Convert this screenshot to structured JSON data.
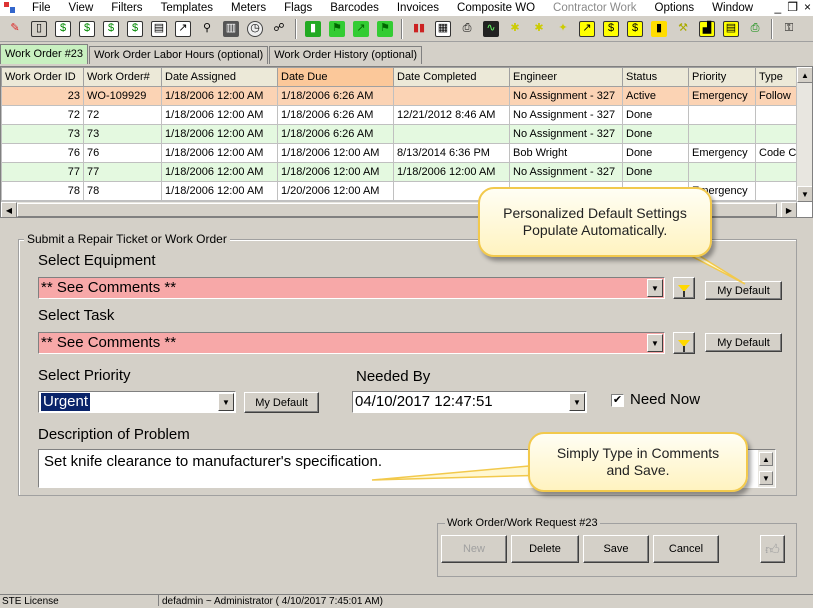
{
  "menu": {
    "items": [
      "File",
      "View",
      "Filters",
      "Templates",
      "Meters",
      "Flags",
      "Barcodes",
      "Invoices",
      "Composite WO",
      "Contractor Work",
      "Options",
      "Window"
    ],
    "disabled": [
      "Contractor Work"
    ],
    "window_controls": {
      "minimize": "_",
      "restore": "❐",
      "close": "×"
    }
  },
  "toolbar": {
    "icons": [
      "wrench-red-icon",
      "trash-icon",
      "dollar-doc-icon",
      "dollar-doc-icon",
      "dollar-doc-icon",
      "dollar-doc-icon",
      "doc-icon",
      "arrow-doc-icon",
      "search-icon",
      "barcode-icon",
      "dial-icon",
      "network-icon",
      "battery-icon",
      "flag-green-icon",
      "arrow-green-icon",
      "flag-green-icon",
      "chart-bar-icon",
      "calendar-icon",
      "printer-icon",
      "chart-icon",
      "robot-icon",
      "robot-icon",
      "sparkle-icon",
      "arrow-yellow-icon",
      "dollar-yellow-icon",
      "dollar-yellow-icon",
      "battery-yellow-icon",
      "tools-icon",
      "chart-yellow-icon",
      "doc-yellow-icon",
      "printer-green-icon",
      "key-icon"
    ]
  },
  "tabs": [
    {
      "label": "Work Order #23",
      "active": true
    },
    {
      "label": "Work Order Labor Hours (optional)",
      "active": false
    },
    {
      "label": "Work Order History (optional)",
      "active": false
    }
  ],
  "grid": {
    "columns": [
      "Work Order ID",
      "Work Order#",
      "Date Assigned",
      "Date Due",
      "Date Completed",
      "Engineer",
      "Status",
      "Priority",
      "Type"
    ],
    "sorted_column": "Date Due",
    "rows": [
      [
        "23",
        "WO-109929",
        "1/18/2006 12:00 AM",
        "1/18/2006 6:26 AM",
        "",
        "No Assignment - 327",
        "Active",
        "Emergency",
        "Follow"
      ],
      [
        "72",
        "72",
        "1/18/2006 12:00 AM",
        "1/18/2006 6:26 AM",
        "12/21/2012 8:46 AM",
        "No Assignment - 327",
        "Done",
        "",
        ""
      ],
      [
        "73",
        "73",
        "1/18/2006 12:00 AM",
        "1/18/2006 6:26 AM",
        "",
        "No Assignment - 327",
        "Done",
        "",
        ""
      ],
      [
        "76",
        "76",
        "1/18/2006 12:00 AM",
        "1/18/2006 12:00 AM",
        "8/13/2014 6:36 PM",
        "Bob Wright",
        "Done",
        "Emergency",
        "Code C"
      ],
      [
        "77",
        "77",
        "1/18/2006 12:00 AM",
        "1/18/2006 12:00 AM",
        "1/18/2006 12:00 AM",
        "No Assignment - 327",
        "Done",
        "",
        ""
      ],
      [
        "78",
        "78",
        "1/18/2006 12:00 AM",
        "1/20/2006 12:00 AM",
        "",
        "",
        "",
        "Emergency",
        ""
      ]
    ]
  },
  "form": {
    "group_title": "Submit a Repair Ticket or Work Order",
    "equipment": {
      "label": "Select Equipment",
      "value": "** See Comments **",
      "default_button": "My Default"
    },
    "task": {
      "label": "Select Task",
      "value": "** See Comments **",
      "default_button": "My Default"
    },
    "priority": {
      "label": "Select Priority",
      "value": "Urgent",
      "default_button": "My Default"
    },
    "needed_by": {
      "label": "Needed By",
      "value": "04/10/2017 12:47:51"
    },
    "need_now": {
      "label": "Need Now",
      "checked": true
    },
    "description": {
      "label": "Description of Problem",
      "value": "Set knife clearance to manufacturer's specification."
    }
  },
  "callouts": {
    "defaults": "Personalized Default Settings Populate Automatically.",
    "comments": "Simply Type in Comments and Save."
  },
  "work_order_panel": {
    "title": "Work Order/Work Request #23",
    "buttons": {
      "new": "New",
      "delete": "Delete",
      "save": "Save",
      "cancel": "Cancel"
    }
  },
  "statusbar": {
    "license": "STE License",
    "user": "defadmin ~ Administrator ( 4/10/2017 7:45:01 AM)"
  },
  "colors": {
    "selected_row": "#fbd3b4",
    "alt_row": "#e4f9e0",
    "required_field": "#f7a8a8",
    "active_tab": "#c8f0c0",
    "callout_border": "#f2c94c"
  }
}
